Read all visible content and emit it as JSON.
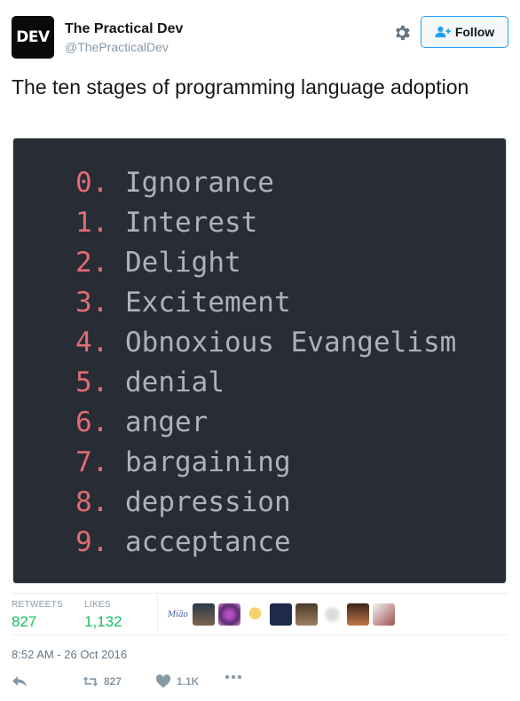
{
  "account": {
    "avatar_text": "DEV",
    "display_name": "The Practical Dev",
    "handle": "@ThePracticalDev",
    "follow_label": "Follow"
  },
  "tweet": {
    "text": "The ten stages of programming language adoption",
    "stages": [
      {
        "num": "0.",
        "label": "Ignorance"
      },
      {
        "num": "1.",
        "label": "Interest"
      },
      {
        "num": "2.",
        "label": "Delight"
      },
      {
        "num": "3.",
        "label": "Excitement"
      },
      {
        "num": "4.",
        "label": "Obnoxious Evangelism"
      },
      {
        "num": "5.",
        "label": "denial"
      },
      {
        "num": "6.",
        "label": "anger"
      },
      {
        "num": "7.",
        "label": "bargaining"
      },
      {
        "num": "8.",
        "label": "depression"
      },
      {
        "num": "9.",
        "label": "acceptance"
      }
    ],
    "timestamp": "8:52 AM - 26 Oct 2016"
  },
  "stats": {
    "retweets_label": "RETWEETS",
    "retweets_value": "827",
    "likes_label": "LIKES",
    "likes_value": "1,132",
    "first_liker_text": "Mião"
  },
  "actions": {
    "retweet_count": "827",
    "like_count": "1.1K"
  },
  "colors": {
    "accent": "#1da1f2",
    "stat_green": "#17bf63",
    "code_bg": "#282c34",
    "code_number": "#e06c75",
    "code_text": "#abb2bf"
  }
}
